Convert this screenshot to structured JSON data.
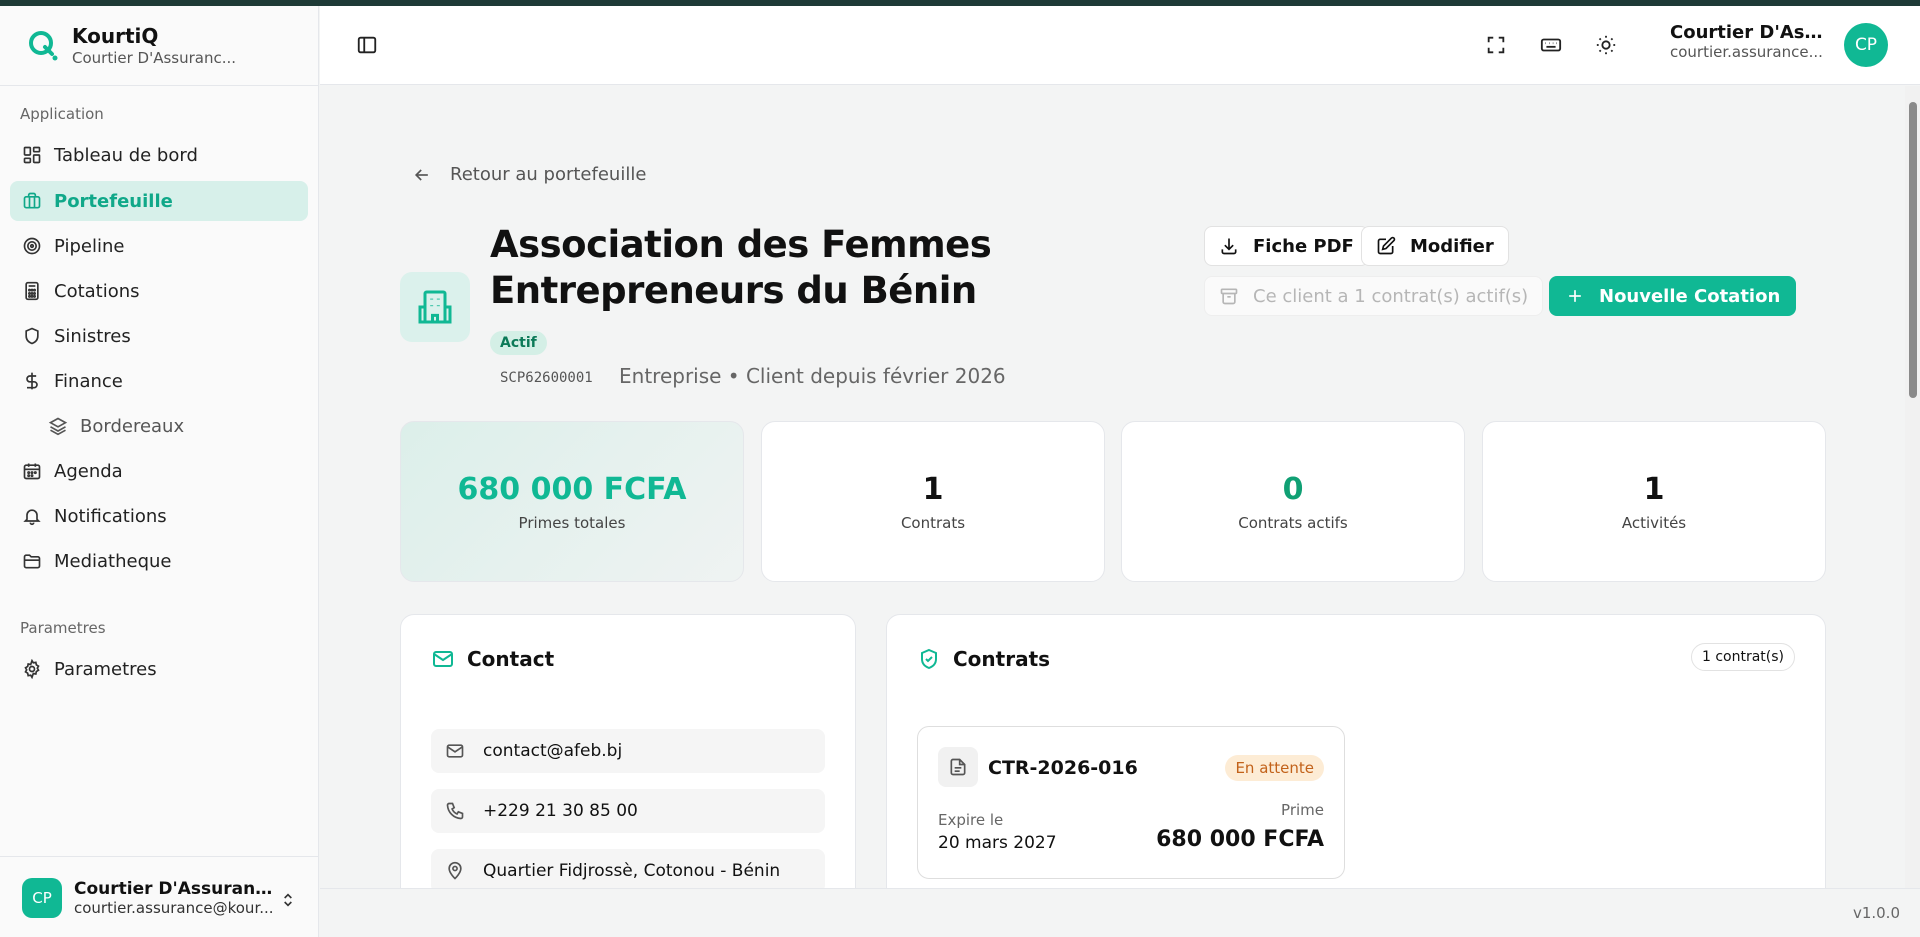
{
  "brand": {
    "name": "KourtiQ",
    "subtitle": "Courtier D'Assuranc..."
  },
  "sidebar": {
    "group_application": "Application",
    "group_parametres": "Parametres",
    "items": [
      {
        "label": "Tableau de bord",
        "icon": "dashboard-icon"
      },
      {
        "label": "Portefeuille",
        "icon": "briefcase-icon",
        "active": true
      },
      {
        "label": "Pipeline",
        "icon": "target-icon"
      },
      {
        "label": "Cotations",
        "icon": "calculator-icon"
      },
      {
        "label": "Sinistres",
        "icon": "shield-icon"
      },
      {
        "label": "Finance",
        "icon": "dollar-icon"
      },
      {
        "label": "Bordereaux",
        "icon": "layers-icon",
        "sub": true
      },
      {
        "label": "Agenda",
        "icon": "calendar-icon"
      },
      {
        "label": "Notifications",
        "icon": "bell-icon"
      },
      {
        "label": "Mediatheque",
        "icon": "folder-icon"
      }
    ],
    "settings_item": "Parametres",
    "user": {
      "initials": "CP",
      "name": "Courtier D'Assurance...",
      "email": "courtier.assurance@kour..."
    }
  },
  "header": {
    "user_name": "Courtier D'Assur...",
    "user_email": "courtier.assurance...",
    "initials": "CP"
  },
  "page": {
    "back_label": "Retour au portefeuille",
    "title": "Association des Femmes Entrepreneurs du Bénin",
    "status": "Actif",
    "code": "SCP62600001",
    "meta": "Entreprise • Client depuis février 2026",
    "actions": {
      "pdf": "Fiche PDF",
      "edit": "Modifier",
      "archive_disabled": "Ce client a 1 contrat(s) actif(s)",
      "new_quote": "Nouvelle Cotation"
    }
  },
  "stats": [
    {
      "value": "680 000 FCFA",
      "label": "Primes totales"
    },
    {
      "value": "1",
      "label": "Contrats"
    },
    {
      "value": "0",
      "label": "Contrats actifs"
    },
    {
      "value": "1",
      "label": "Activités"
    }
  ],
  "contact": {
    "title": "Contact",
    "email": "contact@afeb.bj",
    "phone": "+229 21 30 85 00",
    "address": "Quartier Fidjrossè, Cotonou - Bénin"
  },
  "contracts": {
    "title": "Contrats",
    "count": "1 contrat(s)",
    "items": [
      {
        "ref": "CTR-2026-016",
        "status": "En attente",
        "expires_label": "Expire le",
        "expires": "20 mars 2027",
        "prime_label": "Prime",
        "prime": "680 000 FCFA"
      }
    ]
  },
  "footer": {
    "version": "v1.0.0"
  },
  "colors": {
    "accent": "#10b894",
    "accent_light": "#d7f0ea",
    "pending": "#c2621a"
  }
}
